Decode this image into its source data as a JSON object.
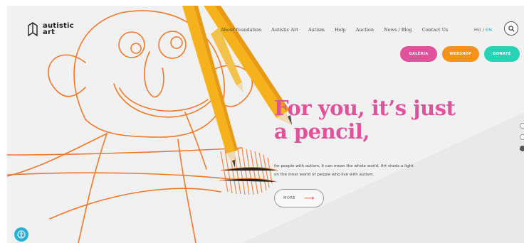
{
  "brand": {
    "name_line1": "autistic",
    "name_line2": "art"
  },
  "nav": {
    "items": [
      "About foundation",
      "Autistic Art",
      "Autism",
      "Help",
      "Auction",
      "News / Blog",
      "Contact Us"
    ],
    "lang_hu": "HU",
    "lang_sep": "/",
    "lang_en": "EN"
  },
  "actions": {
    "galeria": "GALÉRIA",
    "webshop": "WEBSHOP",
    "donate": "DONATE"
  },
  "hero": {
    "headline_line1": "For you, it’s just",
    "headline_line2": "a pencil,",
    "subtext_line1": "for people with autism, it can mean the whole world. Art sheds a light",
    "subtext_line2": "on the inner world of people who live with autism.",
    "more_label": "MORE",
    "more_arrow": "⟶"
  },
  "colors": {
    "pink": "#e0529b",
    "orange": "#f5921d",
    "teal": "#27d3b4",
    "accent_blue": "#2ab0d6",
    "drawing": "#f07a2a"
  },
  "icons": {
    "search": "search-icon",
    "accessibility": "accessibility-icon",
    "logo": "box-logo-icon"
  }
}
